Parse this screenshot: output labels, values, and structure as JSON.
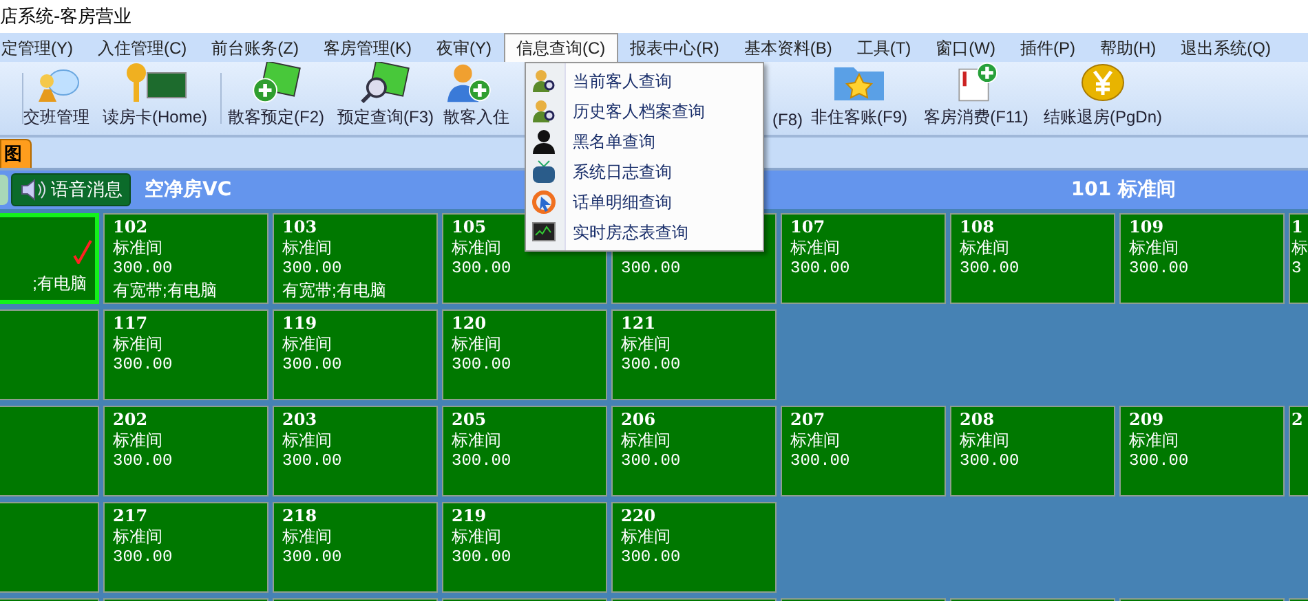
{
  "window": {
    "title": "店系统-客房营业"
  },
  "menu_bar": [
    {
      "label": "定管理(Y)",
      "selected": false
    },
    {
      "label": "入住管理(C)",
      "selected": false
    },
    {
      "label": "前台账务(Z)",
      "selected": false
    },
    {
      "label": "客房管理(K)",
      "selected": false
    },
    {
      "label": "夜审(Y)",
      "selected": false
    },
    {
      "label": "信息查询(C)",
      "selected": true
    },
    {
      "label": "报表中心(R)",
      "selected": false
    },
    {
      "label": "基本资料(B)",
      "selected": false
    },
    {
      "label": "工具(T)",
      "selected": false
    },
    {
      "label": "窗口(W)",
      "selected": false
    },
    {
      "label": "插件(P)",
      "selected": false
    },
    {
      "label": "帮助(H)",
      "selected": false
    },
    {
      "label": "退出系统(Q)",
      "selected": false
    }
  ],
  "dropdown": [
    "当前客人查询",
    "历史客人档案查询",
    "黑名单查询",
    "系统日志查询",
    "话单明细查询",
    "实时房态表查询"
  ],
  "toolbar": [
    "交班管理",
    "读房卡(Home)",
    "散客预定(F2)",
    "预定查询(F3)",
    "散客入住",
    "(F8)",
    "非住客账(F9)",
    "客房消费(F11)",
    "结账退房(PgDn)"
  ],
  "tabs": [
    {
      "label": "图",
      "selected": true
    }
  ],
  "status_bar": {
    "voice_button": "语音消息",
    "room_state": "空净房VC",
    "current_room": "101 标准间"
  },
  "rooms": [
    [
      {
        "kind": "cut-left",
        "amenities": ";有电脑",
        "selected": true
      },
      {
        "kind": "room",
        "number": "102",
        "type": "标准间",
        "price": "300.00",
        "amenities": "有宽带;有电脑",
        "selected": false
      },
      {
        "kind": "room",
        "number": "103",
        "type": "标准间",
        "price": "300.00",
        "amenities": "有宽带;有电脑",
        "selected": false
      },
      {
        "kind": "room",
        "number": "105",
        "type": "标准间",
        "price": "300.00",
        "selected": false
      },
      {
        "kind": "room",
        "price": "300.00",
        "selected": false
      },
      {
        "kind": "room",
        "number": "107",
        "type": "标准间",
        "price": "300.00",
        "selected": false
      },
      {
        "kind": "room",
        "number": "108",
        "type": "标准间",
        "price": "300.00",
        "selected": false
      },
      {
        "kind": "room",
        "number": "109",
        "type": "标准间",
        "price": "300.00",
        "selected": false
      },
      {
        "kind": "cut-right",
        "number": "1",
        "type": "标",
        "price": "3",
        "selected": false
      }
    ],
    [
      {
        "kind": "cut-left",
        "selected": false
      },
      {
        "kind": "room",
        "number": "117",
        "type": "标准间",
        "price": "300.00",
        "selected": false
      },
      {
        "kind": "room",
        "number": "119",
        "type": "标准间",
        "price": "300.00",
        "selected": false
      },
      {
        "kind": "room",
        "number": "120",
        "type": "标准间",
        "price": "300.00",
        "selected": false
      },
      {
        "kind": "room",
        "number": "121",
        "type": "标准间",
        "price": "300.00",
        "selected": false
      },
      {
        "kind": "empty"
      },
      {
        "kind": "empty"
      },
      {
        "kind": "empty"
      },
      {
        "kind": "empty"
      }
    ],
    [
      {
        "kind": "cut-left",
        "selected": false
      },
      {
        "kind": "room",
        "number": "202",
        "type": "标准间",
        "price": "300.00",
        "selected": false
      },
      {
        "kind": "room",
        "number": "203",
        "type": "标准间",
        "price": "300.00",
        "selected": false
      },
      {
        "kind": "room",
        "number": "205",
        "type": "标准间",
        "price": "300.00",
        "selected": false
      },
      {
        "kind": "room",
        "number": "206",
        "type": "标准间",
        "price": "300.00",
        "selected": false
      },
      {
        "kind": "room",
        "number": "207",
        "type": "标准间",
        "price": "300.00",
        "selected": false
      },
      {
        "kind": "room",
        "number": "208",
        "type": "标准间",
        "price": "300.00",
        "selected": false
      },
      {
        "kind": "room",
        "number": "209",
        "type": "标准间",
        "price": "300.00",
        "selected": false
      },
      {
        "kind": "cut-right",
        "number": "2",
        "selected": false
      }
    ],
    [
      {
        "kind": "cut-left",
        "selected": false
      },
      {
        "kind": "room",
        "number": "217",
        "type": "标准间",
        "price": "300.00",
        "selected": false
      },
      {
        "kind": "room",
        "number": "218",
        "type": "标准间",
        "price": "300.00",
        "selected": false
      },
      {
        "kind": "room",
        "number": "219",
        "type": "标准间",
        "price": "300.00",
        "selected": false
      },
      {
        "kind": "room",
        "number": "220",
        "type": "标准间",
        "price": "300.00",
        "selected": false
      },
      {
        "kind": "empty"
      },
      {
        "kind": "empty"
      },
      {
        "kind": "empty"
      },
      {
        "kind": "empty"
      }
    ],
    [
      {
        "kind": "cut-left",
        "selected": false
      },
      {
        "kind": "room",
        "selected": false
      },
      {
        "kind": "room",
        "selected": false
      },
      {
        "kind": "room",
        "selected": false
      },
      {
        "kind": "room",
        "selected": false
      },
      {
        "kind": "room",
        "selected": false
      },
      {
        "kind": "room",
        "selected": false
      },
      {
        "kind": "room",
        "selected": false
      },
      {
        "kind": "room",
        "selected": false
      }
    ]
  ]
}
